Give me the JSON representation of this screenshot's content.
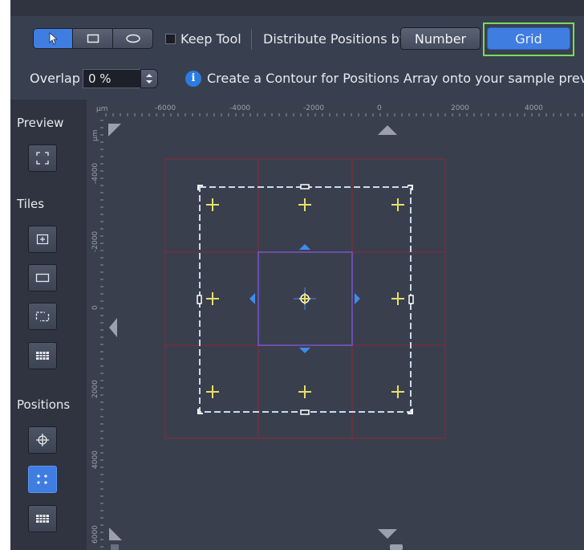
{
  "toolbar": {
    "keep_tool_label": "Keep Tool",
    "keep_tool_checked": false,
    "distribute_label": "Distribute Positions by",
    "number_label": "Number",
    "grid_label": "Grid",
    "selected_distribution": "Grid",
    "overlap_label": "Overlap",
    "overlap_value": "0 %",
    "info_text": "Create a Contour for Positions Array onto your sample preview",
    "tools": [
      "pointer-tool",
      "rectangle-tool",
      "ellipse-tool"
    ],
    "active_tool": "pointer-tool"
  },
  "sidebar": {
    "preview_label": "Preview",
    "tiles_label": "Tiles",
    "positions_label": "Positions",
    "active_positions_tool": "grid-positions"
  },
  "ruler": {
    "unit": "µm",
    "x_ticks": [
      "-6000",
      "-4000",
      "-2000",
      "0",
      "2000",
      "4000"
    ],
    "y_ticks": [
      "-4000",
      "-2000",
      "0",
      "2000",
      "4000",
      "6000"
    ]
  },
  "grid": {
    "rows": 3,
    "cols": 3,
    "center_selected": true
  },
  "colors": {
    "accent": "#3f7de0",
    "highlight": "#7ed957",
    "grid_lines": "#8a2a35",
    "marker": "#e6e06a",
    "contour": "#c8dcea",
    "center_box": "#7b55c8"
  }
}
